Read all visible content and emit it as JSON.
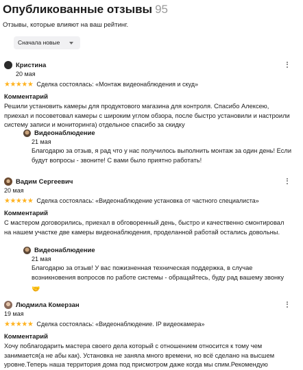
{
  "header": {
    "title": "Опубликованные отзывы",
    "count": "95",
    "subtitle": "Отзывы, которые влияют на ваш рейтинг.",
    "sort_label": "Сначала новые"
  },
  "colors": {
    "star": "#ffb21e",
    "sort_bg": "#f1f1f3",
    "muted": "#9a9a9a"
  },
  "reviews": [
    {
      "name": "Кристина",
      "date": "20 мая",
      "stars": "★★★★★",
      "deal": "Сделка состоялась: «Монтаж видеонаблюдения и скуд»",
      "comment_label": "Комментарий",
      "comment": "Решили установить камеры для продуктового магазина для контроля. Спасибо Алексею, приехал и посоветовал камеры с широким углом обзора, после быстро установили и настроили систему записи и мониторинга) отдельное спасибо за скидку",
      "reply": {
        "name": "Видеонаблюдение",
        "date": "21 мая",
        "text": "Благодарю за отзыв, я рад что у нас получилось выполнить монтаж за один день! Если будут вопросы - звоните! С вами было приятно работать!"
      }
    },
    {
      "name": "Вадим Сергеевич",
      "date": "20 мая",
      "stars": "★★★★★",
      "deal": "Сделка состоялась: «Видеонаблюдение установка от частного специалиста»",
      "comment_label": "Комментарий",
      "comment": "С мастером договорились, приехал в обговоренный день, быстро и качественно смонтировал на нашем участке две камеры видеонаблюдения, проделанной работай остались довольны.",
      "reply": {
        "name": "Видеонаблюдение",
        "date": "21 мая",
        "text": "Благодарю за отзыв! У вас пожизненная техническая поддержка, в случае возникновения вопросов по работе системы - обращайтесь, буду рад вашему звонку",
        "emoji": "🤝"
      }
    },
    {
      "name": "Людмила Комерзан",
      "date": "19 мая",
      "stars": "★★★★★",
      "deal": "Сделка состоялась: «Видеонаблюдение. IP видеокамера»",
      "comment_label": "Комментарий",
      "comment": "Хочу поблагодарить мастера своего дела который с отношением относится к тому чем занимается(а не абы как). Установка не заняла много времени, но всё сделано на высшем уровне.Теперь наша территория дома под присмотром даже когда мы спим.Рекомендую"
    }
  ]
}
